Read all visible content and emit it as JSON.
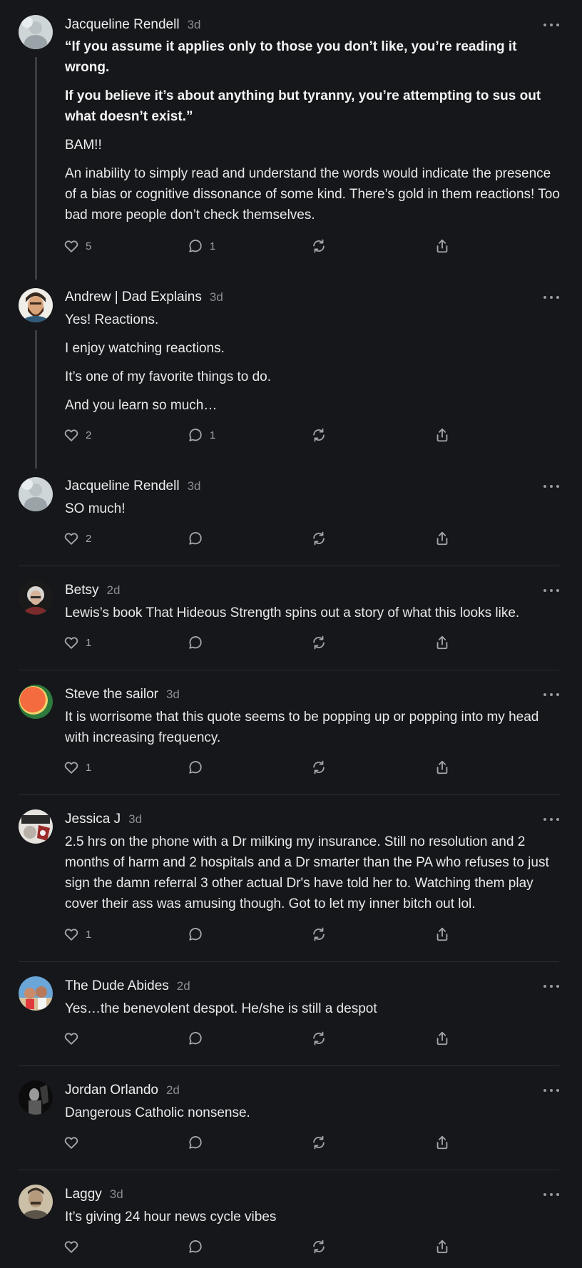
{
  "comments": [
    {
      "author": "Jacqueline Rendell",
      "time": "3d",
      "paragraphs": [
        "“If you assume it applies only to those you don’t like, you’re reading it wrong.",
        "If you believe it’s about anything but tyranny, you’re attempting to sus out what doesn’t exist.”",
        "BAM!!",
        "An inability to simply read and understand the words would indicate the presence of a bias or cognitive dissonance of some kind. There’s gold in them reactions! Too bad more people don’t check themselves."
      ],
      "likes": "5",
      "replies": "1"
    },
    {
      "author": "Andrew | Dad Explains",
      "time": "3d",
      "paragraphs": [
        "Yes! Reactions.",
        "I enjoy watching reactions.",
        "It’s one of my favorite things to do.",
        "And you learn so much…"
      ],
      "likes": "2",
      "replies": "1"
    },
    {
      "author": "Jacqueline Rendell",
      "time": "3d",
      "paragraphs": [
        "SO much!"
      ],
      "likes": "2",
      "replies": ""
    },
    {
      "author": "Betsy",
      "time": "2d",
      "paragraphs": [
        "Lewis’s book That Hideous Strength spins out a story of what this looks like."
      ],
      "likes": "1",
      "replies": ""
    },
    {
      "author": "Steve the sailor",
      "time": "3d",
      "paragraphs": [
        "It is worrisome that this quote seems to be popping up or popping into my head with increasing frequency."
      ],
      "likes": "1",
      "replies": ""
    },
    {
      "author": "Jessica J",
      "time": "3d",
      "paragraphs": [
        "2.5 hrs on the phone with a Dr milking my insurance. Still no resolution and 2 months of harm and 2 hospitals and a Dr smarter than the PA who refuses to just sign the damn referral 3 other actual Dr's have told her to. Watching them play cover their ass was amusing though. Got to let my inner bitch out lol."
      ],
      "likes": "1",
      "replies": ""
    },
    {
      "author": "The Dude Abides",
      "time": "2d",
      "paragraphs": [
        "Yes…the benevolent despot. He/she is still a despot"
      ],
      "likes": "",
      "replies": ""
    },
    {
      "author": "Jordan Orlando",
      "time": "2d",
      "paragraphs": [
        "Dangerous Catholic nonsense."
      ],
      "likes": "",
      "replies": ""
    },
    {
      "author": "Laggy",
      "time": "3d",
      "paragraphs": [
        "It’s giving 24 hour news cycle vibes"
      ],
      "likes": "",
      "replies": ""
    }
  ],
  "icons": {
    "like": "heart-icon",
    "reply": "comment-bubble-icon",
    "restack": "restack-icon",
    "share": "share-icon",
    "more": "more-options-icon"
  },
  "colors": {
    "background": "#16171a",
    "text": "#e9e9ea",
    "muted": "#8c8d91",
    "divider": "#2c2d31"
  }
}
